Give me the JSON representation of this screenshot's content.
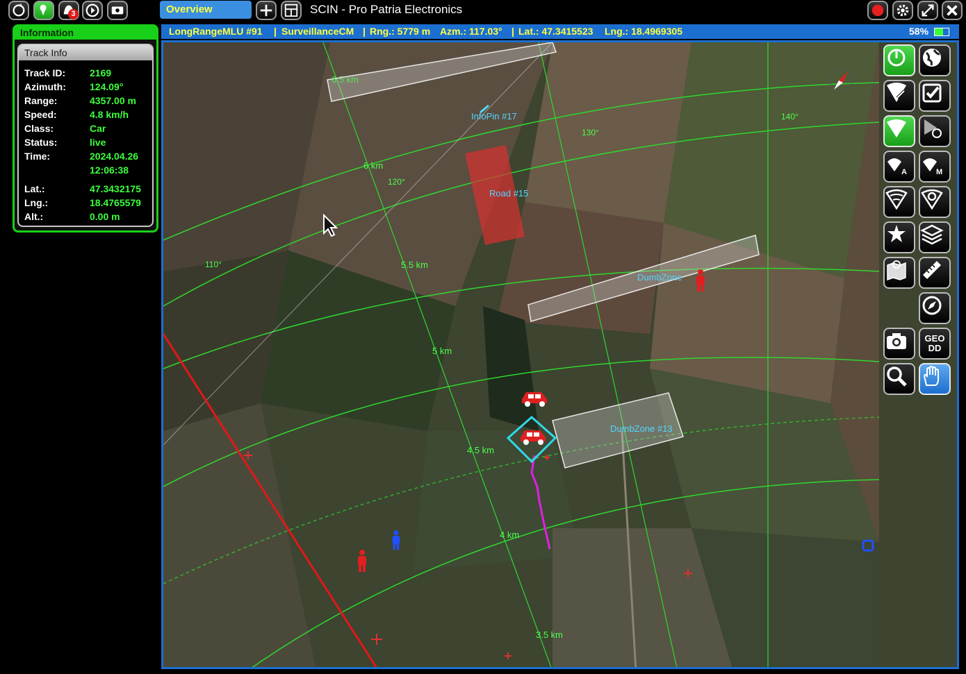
{
  "toolbar": {
    "left_icons": [
      "refresh-icon",
      "map-pin-icon",
      "alert-icon",
      "play-icon",
      "dish-icon"
    ],
    "alert_count": "3",
    "tab_label": "Overview",
    "app_title": "SCIN  - Pro Patria Electronics",
    "right_icons": [
      "record-icon",
      "settings-icon",
      "fullscreen-icon",
      "close-icon"
    ]
  },
  "info_panel": {
    "header": "Information",
    "section_title": "Track Info",
    "rows": [
      {
        "label": "Track ID:",
        "value": "2169"
      },
      {
        "label": "Azimuth:",
        "value": "124.09°"
      },
      {
        "label": "Range:",
        "value": "4357.00 m"
      },
      {
        "label": "Speed:",
        "value": "4.8 km/h"
      },
      {
        "label": "Class:",
        "value": "Car"
      },
      {
        "label": "Status:",
        "value": "live"
      },
      {
        "label": "Time:",
        "value": "2024.04.26"
      },
      {
        "label": "",
        "value": "12:06:38"
      },
      {
        "label": "Lat.:",
        "value": "47.3432175"
      },
      {
        "label": "Lng.:",
        "value": "18.4765579"
      },
      {
        "label": "Alt.:",
        "value": "0.00 m"
      }
    ]
  },
  "status_bar": {
    "device": "LongRangeMLU #91",
    "mode": "SurveillanceCM",
    "range": "Rng.: 5779 m",
    "azimuth": "Azm.: 117.03°",
    "lat": "Lat.: 47.3415523",
    "lng": "Lng.: 18.4969305",
    "battery": "58%",
    "sep": "|"
  },
  "map": {
    "range_labels": [
      "6.5 km",
      "6 km",
      "5.5 km",
      "5 km",
      "4.5 km",
      "4 km",
      "3.5 km"
    ],
    "azimuth_labels": [
      "110°",
      "120°",
      "130°",
      "140°"
    ],
    "zones": {
      "infopin": "InfoPin #17",
      "road": "Road #15",
      "dumbzone_a": "DumbZone",
      "dumbzone_b": "DumbZone #13"
    },
    "colors": {
      "grid": "#2fd82f",
      "zone_label": "#52d6ff",
      "alert_line": "#e01818",
      "trail": "#e020e0"
    }
  },
  "side_tools": [
    "power-icon",
    "globe-icon",
    "radar-settings-icon",
    "checklist-icon",
    "radar-beam-icon",
    "navigate-icon",
    "auto-scan-icon",
    "manual-scan-icon",
    "sector-icon",
    "search-zone-icon",
    "pin-icon",
    "layers-icon",
    "map-book-icon",
    "ruler-icon",
    "compass-icon",
    "camera-icon",
    "geo-dd-icon",
    "zoom-icon",
    "pan-hand-icon"
  ],
  "side_text": {
    "geo_line1": "GEO",
    "geo_line2": "DD"
  }
}
